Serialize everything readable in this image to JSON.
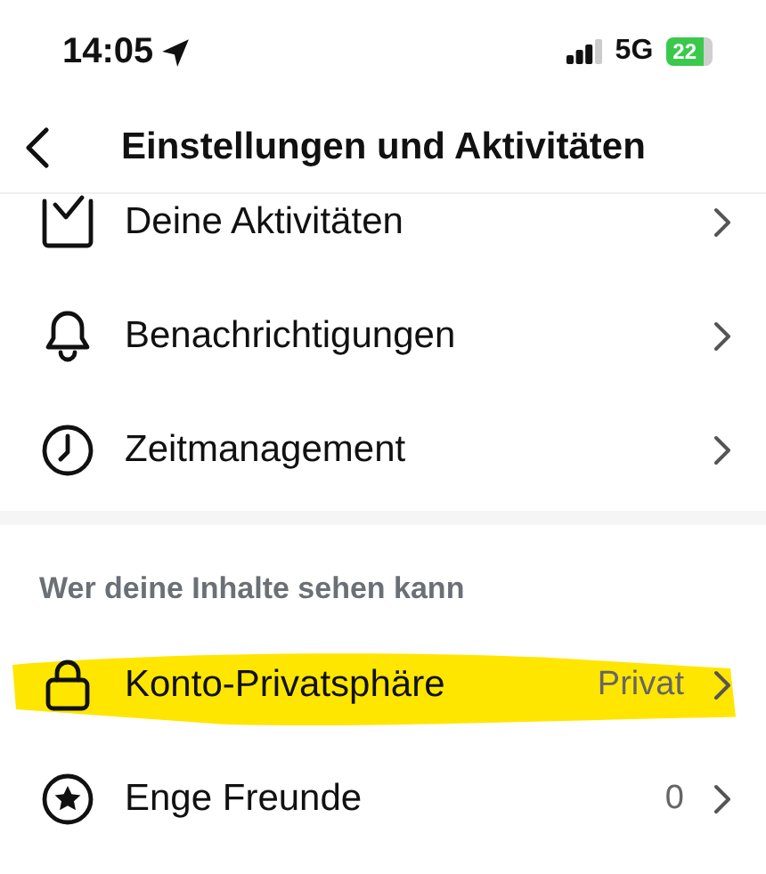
{
  "status_bar": {
    "time": "14:05",
    "network": "5G",
    "battery": "22"
  },
  "header": {
    "title": "Einstellungen und Aktivitäten"
  },
  "sections": [
    {
      "rows": [
        {
          "label": "Deine Aktivitäten",
          "highlighted": false
        },
        {
          "label": "Benachrichtigungen",
          "highlighted": false
        },
        {
          "label": "Zeitmanagement",
          "highlighted": false
        }
      ]
    },
    {
      "title": "Wer deine Inhalte sehen kann",
      "rows": [
        {
          "label": "Konto-Privatsphäre",
          "value": "Privat",
          "highlighted": true
        },
        {
          "label": "Enge Freunde",
          "value": "0",
          "highlighted": false
        }
      ]
    }
  ]
}
